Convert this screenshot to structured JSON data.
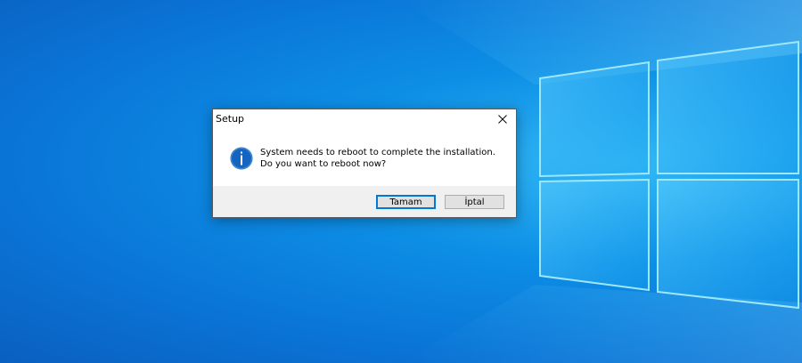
{
  "dialog": {
    "title": "Setup",
    "message": "System needs to reboot to complete the installation. Do you want to reboot now?",
    "icon": "info-icon",
    "buttons": {
      "ok_label": "Tamam",
      "cancel_label": "İptal"
    }
  },
  "colors": {
    "desktop_background": "#0a74d6",
    "accent": "#0078d7",
    "info_icon": "#1565c0"
  }
}
